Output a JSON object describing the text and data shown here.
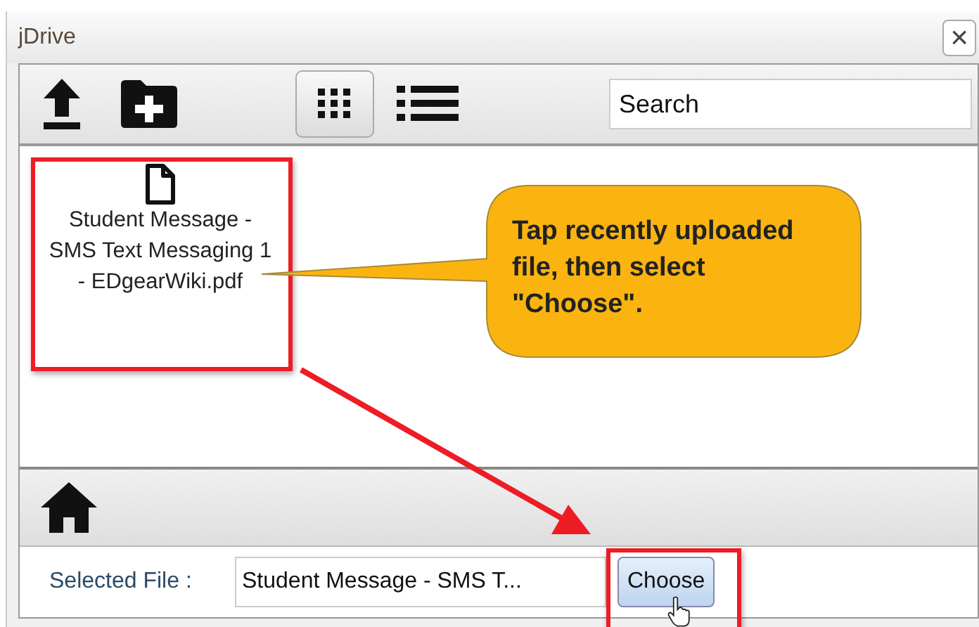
{
  "window": {
    "title": "jDrive",
    "close": "×"
  },
  "toolbar": {
    "views": [
      {
        "kind": "grid",
        "selected": true
      },
      {
        "kind": "list",
        "selected": false
      }
    ],
    "search": {
      "placeholder": "Search"
    }
  },
  "files": [
    {
      "name": "Student Message - SMS Text Messaging 1 - EDgearWiki.pdf",
      "highlighted": true
    }
  ],
  "callout": {
    "text": "Tap recently uploaded file, then select \"Choose\"."
  },
  "selection": {
    "label": "Selected File :",
    "value": "Student Message - SMS T...",
    "button": "Choose",
    "highlighted": true
  }
}
